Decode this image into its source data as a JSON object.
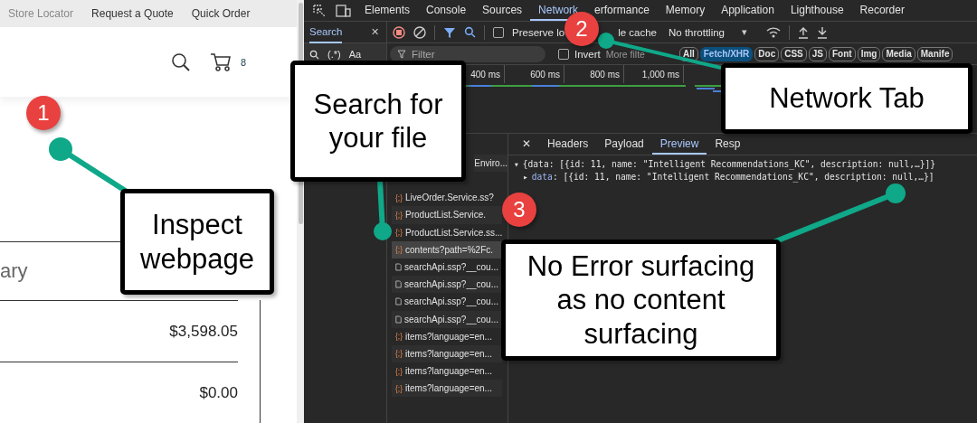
{
  "webpage": {
    "top_links": [
      "Store Locator",
      "Request a Quote",
      "Quick Order"
    ],
    "cart_count": "8",
    "summary_heading": "ary",
    "amounts": [
      "$3,598.05",
      "$0.00"
    ]
  },
  "devtools": {
    "tabs": [
      {
        "label": "Elements",
        "selected": false
      },
      {
        "label": "Console",
        "selected": false
      },
      {
        "label": "Sources",
        "selected": false
      },
      {
        "label": "Network",
        "selected": true
      },
      {
        "label": "erformance",
        "selected": false
      },
      {
        "label": "Memory",
        "selected": false
      },
      {
        "label": "Application",
        "selected": false
      },
      {
        "label": "Lighthouse",
        "selected": false
      },
      {
        "label": "Recorder",
        "selected": false
      }
    ],
    "search_panel": {
      "title": "Search",
      "close": "✕",
      "regex_label": "(.*)",
      "case_label": "Aa"
    },
    "toolbar": {
      "preserve_log": {
        "label": "Preserve lo",
        "checked": false
      },
      "disable_cache": "le cache",
      "throttling": "No throttling",
      "caret": "▾"
    },
    "filter": {
      "placeholder": "Filter",
      "invert": {
        "label": "Invert",
        "checked": false
      },
      "more_filters": "More filte",
      "types": [
        {
          "label": "All",
          "selected": false
        },
        {
          "label": "Fetch/XHR",
          "selected": true
        },
        {
          "label": "Doc",
          "selected": false
        },
        {
          "label": "CSS",
          "selected": false
        },
        {
          "label": "JS",
          "selected": false
        },
        {
          "label": "Font",
          "selected": false
        },
        {
          "label": "Img",
          "selected": false
        },
        {
          "label": "Media",
          "selected": false
        },
        {
          "label": "Manife",
          "selected": false
        }
      ]
    },
    "timeline": {
      "ticks": [
        "400 ms",
        "600 ms",
        "800 ms",
        "1,000 ms"
      ]
    },
    "requests": [
      {
        "kind": "partial",
        "name": "Enviro...",
        "selected": false
      },
      {
        "kind": "xhr",
        "icon": "{;}",
        "name": "LiveOrder.Service.ss?",
        "selected": false
      },
      {
        "kind": "xhr",
        "icon": "{;}",
        "name": "ProductList.Service.",
        "selected": false
      },
      {
        "kind": "xhr",
        "icon": "{;}",
        "name": "ProductList.Service.ss...",
        "selected": false
      },
      {
        "kind": "xhr",
        "icon": "{;}",
        "name": "contents?path=%2Fc.",
        "selected": true
      },
      {
        "kind": "doc",
        "name": "searchApi.ssp?__cou...",
        "selected": false
      },
      {
        "kind": "doc",
        "name": "searchApi.ssp?__cou...",
        "selected": false
      },
      {
        "kind": "doc",
        "name": "searchApi.ssp?__cou...",
        "selected": false
      },
      {
        "kind": "doc",
        "name": "searchApi.ssp?__cou...",
        "selected": false
      },
      {
        "kind": "xhr",
        "icon": "{;}",
        "name": "items?language=en...",
        "selected": false
      },
      {
        "kind": "xhr",
        "icon": "{;}",
        "name": "items?language=en...",
        "selected": false
      },
      {
        "kind": "xhr",
        "icon": "{;}",
        "name": "items?language=en...",
        "selected": false
      },
      {
        "kind": "xhr",
        "icon": "{;}",
        "name": "items?language=en...",
        "selected": false
      }
    ],
    "detail_close": "✕",
    "detail_tabs": [
      {
        "label": "Headers",
        "selected": false
      },
      {
        "label": "Payload",
        "selected": false
      },
      {
        "label": "Preview",
        "selected": true
      },
      {
        "label": "Resp",
        "selected": false
      }
    ],
    "preview": {
      "root_toggle": "▾",
      "root": "{data: [{id: 11, name: \"Intelligent Recommendations_KC\", description: null,…}]}",
      "child_toggle": "▸",
      "child_key": "data",
      "child_value": ": [{id: 11, name: \"Intelligent Recommendations_KC\", description: null,…}]"
    }
  },
  "badges": [
    "1",
    "2",
    "3"
  ],
  "callouts": [
    "Inspect webpage",
    "Search for your file",
    "Network Tab",
    "No Error surfacing as no content surfacing"
  ]
}
